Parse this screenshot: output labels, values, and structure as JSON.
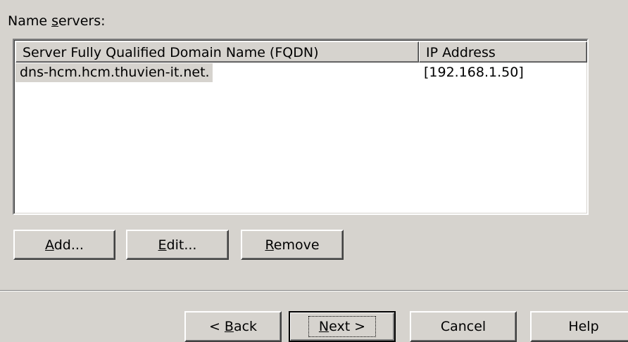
{
  "name_servers_label": {
    "prefix": "Name ",
    "mnemonic": "s",
    "suffix": "ervers:"
  },
  "list": {
    "columns": [
      "Server Fully Qualified Domain Name (FQDN)",
      "IP Address"
    ],
    "rows": [
      {
        "fqdn": "dns-hcm.hcm.thuvien-it.net.",
        "ip": "[192.168.1.50]"
      }
    ]
  },
  "actions": {
    "add": {
      "mnemonic": "A",
      "rest": "dd..."
    },
    "edit": {
      "mnemonic": "E",
      "rest": "dit..."
    },
    "remove": {
      "mnemonic": "R",
      "rest": "emove"
    }
  },
  "wizard": {
    "back": {
      "prefix": "< ",
      "mnemonic": "B",
      "rest": "ack"
    },
    "next": {
      "mnemonic": "N",
      "rest": "ext >"
    },
    "cancel": "Cancel",
    "help": "Help"
  }
}
